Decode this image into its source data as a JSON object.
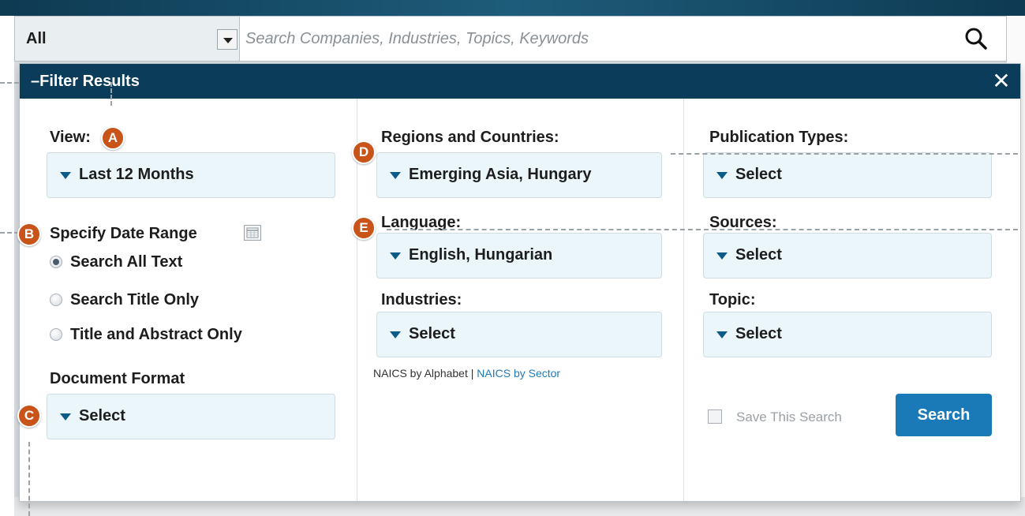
{
  "search": {
    "scope_label": "All",
    "placeholder": "Search Companies, Industries, Topics, Keywords"
  },
  "panel": {
    "title": "Filter Results",
    "close_symbol": "✕"
  },
  "left_col": {
    "view_label": "View:",
    "view_value": "Last 12 Months",
    "date_range_label": "Specify Date Range",
    "radios": [
      {
        "label": "Search All Text",
        "checked": true
      },
      {
        "label": "Search Title Only",
        "checked": false
      },
      {
        "label": "Title and Abstract Only",
        "checked": false
      }
    ],
    "doc_format_label": "Document Format",
    "doc_format_value": "Select"
  },
  "mid_col": {
    "regions_label": "Regions and Countries:",
    "regions_value": "Emerging Asia, Hungary",
    "language_label": "Language:",
    "language_value": "English, Hungarian",
    "industries_label": "Industries:",
    "industries_value": "Select",
    "naics_alpha": "NAICS by Alphabet",
    "naics_sep": " | ",
    "naics_sector": "NAICS by Sector"
  },
  "right_col": {
    "pub_types_label": "Publication Types:",
    "pub_types_value": "Select",
    "sources_label": "Sources:",
    "sources_value": "Select",
    "topic_label": "Topic:",
    "topic_value": "Select",
    "save_label": "Save This Search",
    "search_button": "Search"
  },
  "callouts": {
    "a": "A",
    "b": "B",
    "c": "C",
    "d": "D",
    "e": "E"
  },
  "colors": {
    "header": "#0b3c5a",
    "dropdown_bg": "#eaf6fa",
    "search_button": "#1a7ab8",
    "callout": "#c9541a"
  },
  "icons": {
    "search": "search-icon",
    "close": "close-icon",
    "calendar": "calendar-icon",
    "caret": "caret-down-icon"
  }
}
